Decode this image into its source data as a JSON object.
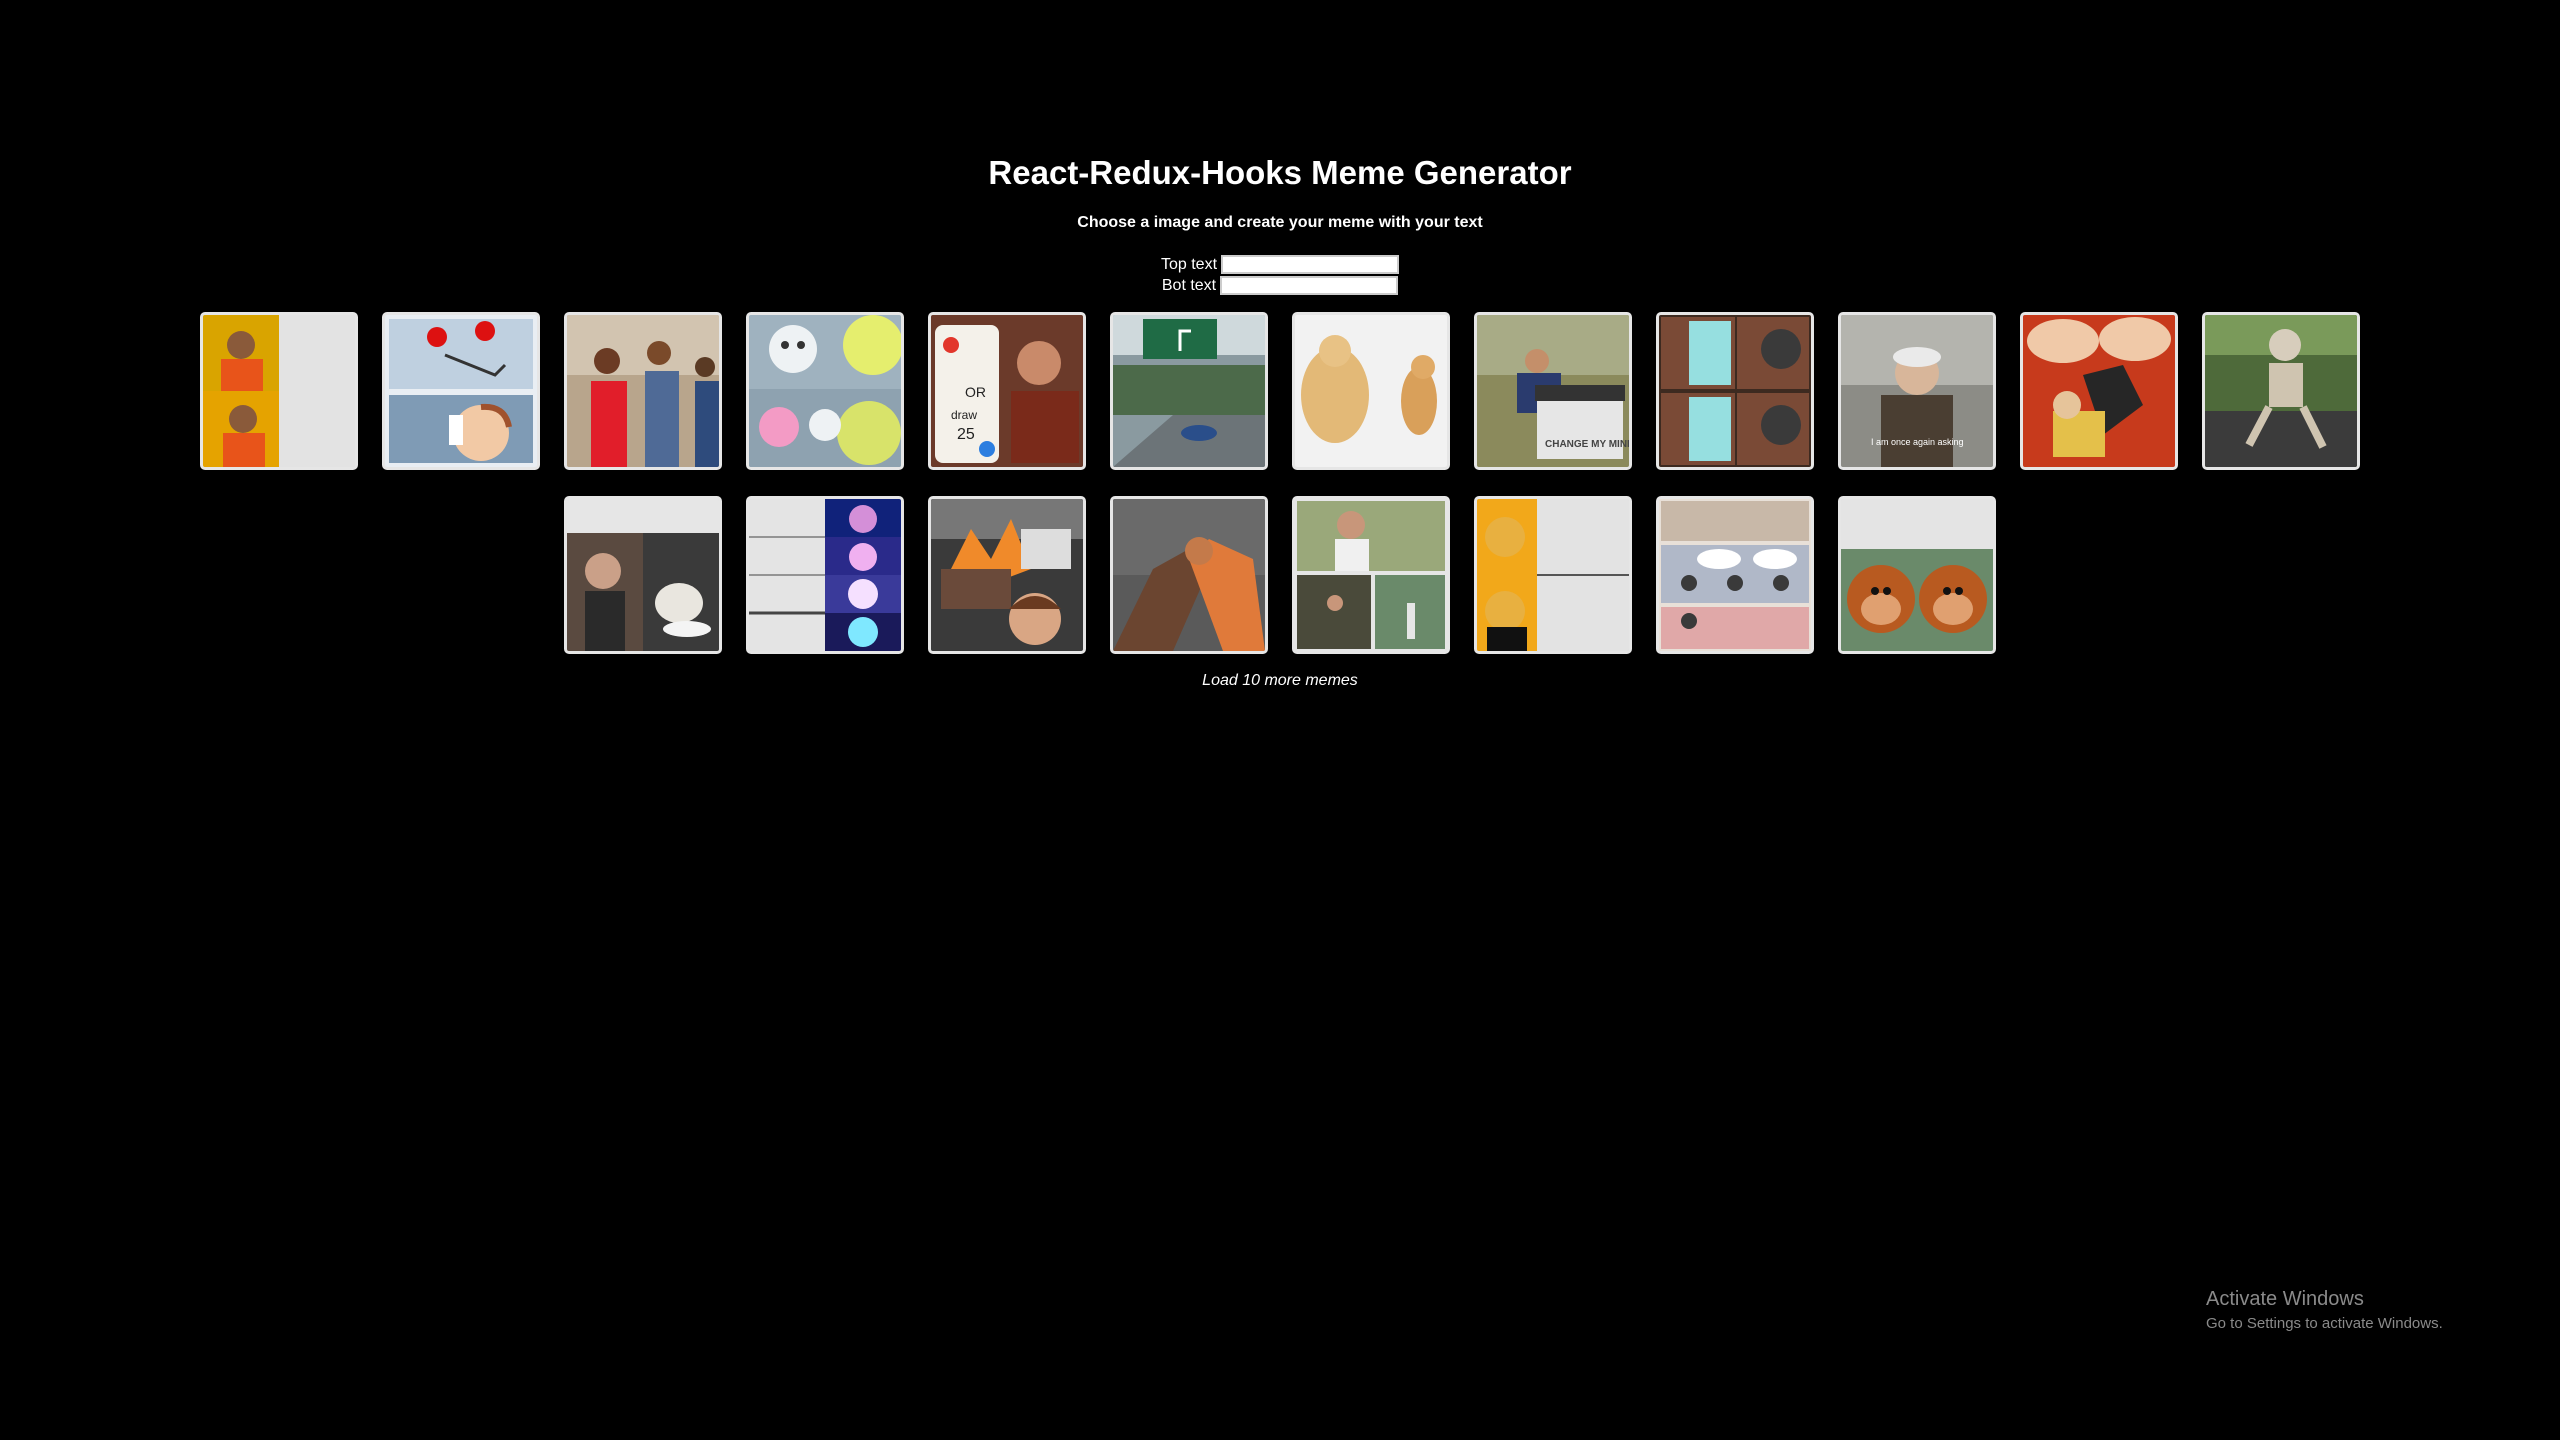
{
  "header": {
    "title": "React-Redux-Hooks Meme Generator",
    "subtitle": "Choose a image and create your meme with your text"
  },
  "form": {
    "top_label": "Top text",
    "top_value": "",
    "bot_label": "Bot text",
    "bot_value": ""
  },
  "memes": {
    "row1": [
      "drake",
      "buttons",
      "distracted-boyfriend",
      "blob-ball",
      "uno-draw-25",
      "left-exit-ramp",
      "buff-doge-vs-cheems",
      "change-my-mind",
      "gru-plan",
      "bernie-once-again-asking",
      "batman-slapping-robin",
      "waiting-skeleton"
    ],
    "row2": [
      "woman-yelling-at-cat",
      "expanding-brain",
      "disaster-girl",
      "epic-handshake",
      "sad-pablo-escobar",
      "tuxedo-winnie-the-pooh",
      "boardroom-meeting",
      "monkey-puppet"
    ],
    "captions": {
      "change_my_mind": "CHANGE MY MIND",
      "bernie": "I am once again asking",
      "uno_or": "OR",
      "uno_draw": "draw",
      "uno_num": "25"
    }
  },
  "actions": {
    "load_more": "Load 10 more memes"
  },
  "watermark": {
    "title": "Activate Windows",
    "subtitle": "Go to Settings to activate Windows."
  }
}
